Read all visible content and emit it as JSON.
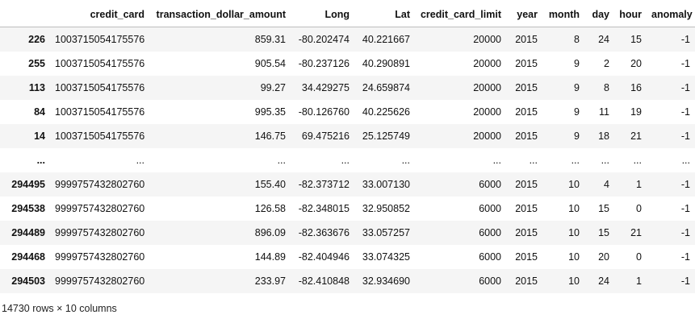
{
  "table": {
    "columns": [
      "",
      "credit_card",
      "transaction_dollar_amount",
      "Long",
      "Lat",
      "credit_card_limit",
      "year",
      "month",
      "day",
      "hour",
      "anomaly"
    ],
    "rows": [
      [
        "226",
        "1003715054175576",
        "859.31",
        "-80.202474",
        "40.221667",
        "20000",
        "2015",
        "8",
        "24",
        "15",
        "-1"
      ],
      [
        "255",
        "1003715054175576",
        "905.54",
        "-80.237126",
        "40.290891",
        "20000",
        "2015",
        "9",
        "2",
        "20",
        "-1"
      ],
      [
        "113",
        "1003715054175576",
        "99.27",
        "34.429275",
        "24.659874",
        "20000",
        "2015",
        "9",
        "8",
        "16",
        "-1"
      ],
      [
        "84",
        "1003715054175576",
        "995.35",
        "-80.126760",
        "40.225626",
        "20000",
        "2015",
        "9",
        "11",
        "19",
        "-1"
      ],
      [
        "14",
        "1003715054175576",
        "146.75",
        "69.475216",
        "25.125749",
        "20000",
        "2015",
        "9",
        "18",
        "21",
        "-1"
      ],
      [
        "...",
        "...",
        "...",
        "...",
        "...",
        "...",
        "...",
        "...",
        "...",
        "...",
        "..."
      ],
      [
        "294495",
        "9999757432802760",
        "155.40",
        "-82.373712",
        "33.007130",
        "6000",
        "2015",
        "10",
        "4",
        "1",
        "-1"
      ],
      [
        "294538",
        "9999757432802760",
        "126.58",
        "-82.348015",
        "32.950852",
        "6000",
        "2015",
        "10",
        "15",
        "0",
        "-1"
      ],
      [
        "294489",
        "9999757432802760",
        "896.09",
        "-82.363676",
        "33.057257",
        "6000",
        "2015",
        "10",
        "15",
        "21",
        "-1"
      ],
      [
        "294468",
        "9999757432802760",
        "144.89",
        "-82.404946",
        "33.074325",
        "6000",
        "2015",
        "10",
        "20",
        "0",
        "-1"
      ],
      [
        "294503",
        "9999757432802760",
        "233.97",
        "-82.410848",
        "32.934690",
        "6000",
        "2015",
        "10",
        "24",
        "1",
        "-1"
      ]
    ]
  },
  "footer": "14730 rows × 10 columns"
}
